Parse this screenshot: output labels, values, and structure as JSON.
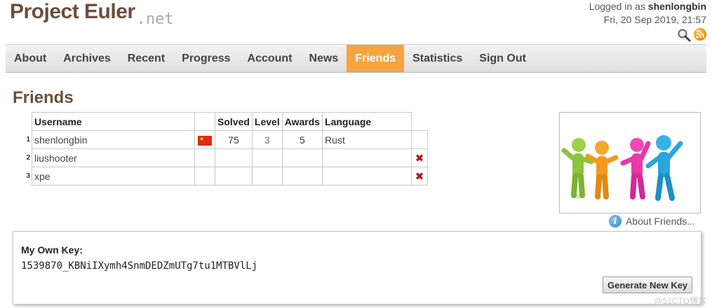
{
  "header": {
    "logo_main": "Project Euler",
    "logo_suffix": ".net",
    "logged_in_prefix": "Logged in as ",
    "username": "shenlongbin",
    "datetime": "Fri, 20 Sep 2019, 21:57",
    "icons": [
      "search-icon",
      "rss-icon"
    ]
  },
  "nav": {
    "items": [
      "About",
      "Archives",
      "Recent",
      "Progress",
      "Account",
      "News",
      "Friends",
      "Statistics",
      "Sign Out"
    ],
    "active": "Friends"
  },
  "page": {
    "title": "Friends"
  },
  "table": {
    "headers": [
      "Username",
      "",
      "Solved",
      "Level",
      "Awards",
      "Language"
    ],
    "rows": [
      {
        "rank": "1",
        "username": "shenlongbin",
        "flag": "CN",
        "solved": "75",
        "level": "3",
        "awards": "5",
        "language": "Rust",
        "deletable": false
      },
      {
        "rank": "2",
        "username": "liushooter",
        "flag": "",
        "solved": "",
        "level": "",
        "awards": "",
        "language": "",
        "deletable": true
      },
      {
        "rank": "3",
        "username": "xpe",
        "flag": "",
        "solved": "",
        "level": "",
        "awards": "",
        "language": "",
        "deletable": true
      }
    ]
  },
  "sidebar": {
    "about_link": "About Friends..."
  },
  "key_panel": {
    "label": "My Own Key:",
    "key": "1539870_KBNiIXymh4SnmDEDZmUTg7tu1MTBVlLj",
    "button": "Generate New Key"
  },
  "watermark": "@51CTO博客",
  "colors": {
    "brand": "#6b4f3e",
    "nav_active": "#f7a340",
    "delete": "#b01010"
  }
}
